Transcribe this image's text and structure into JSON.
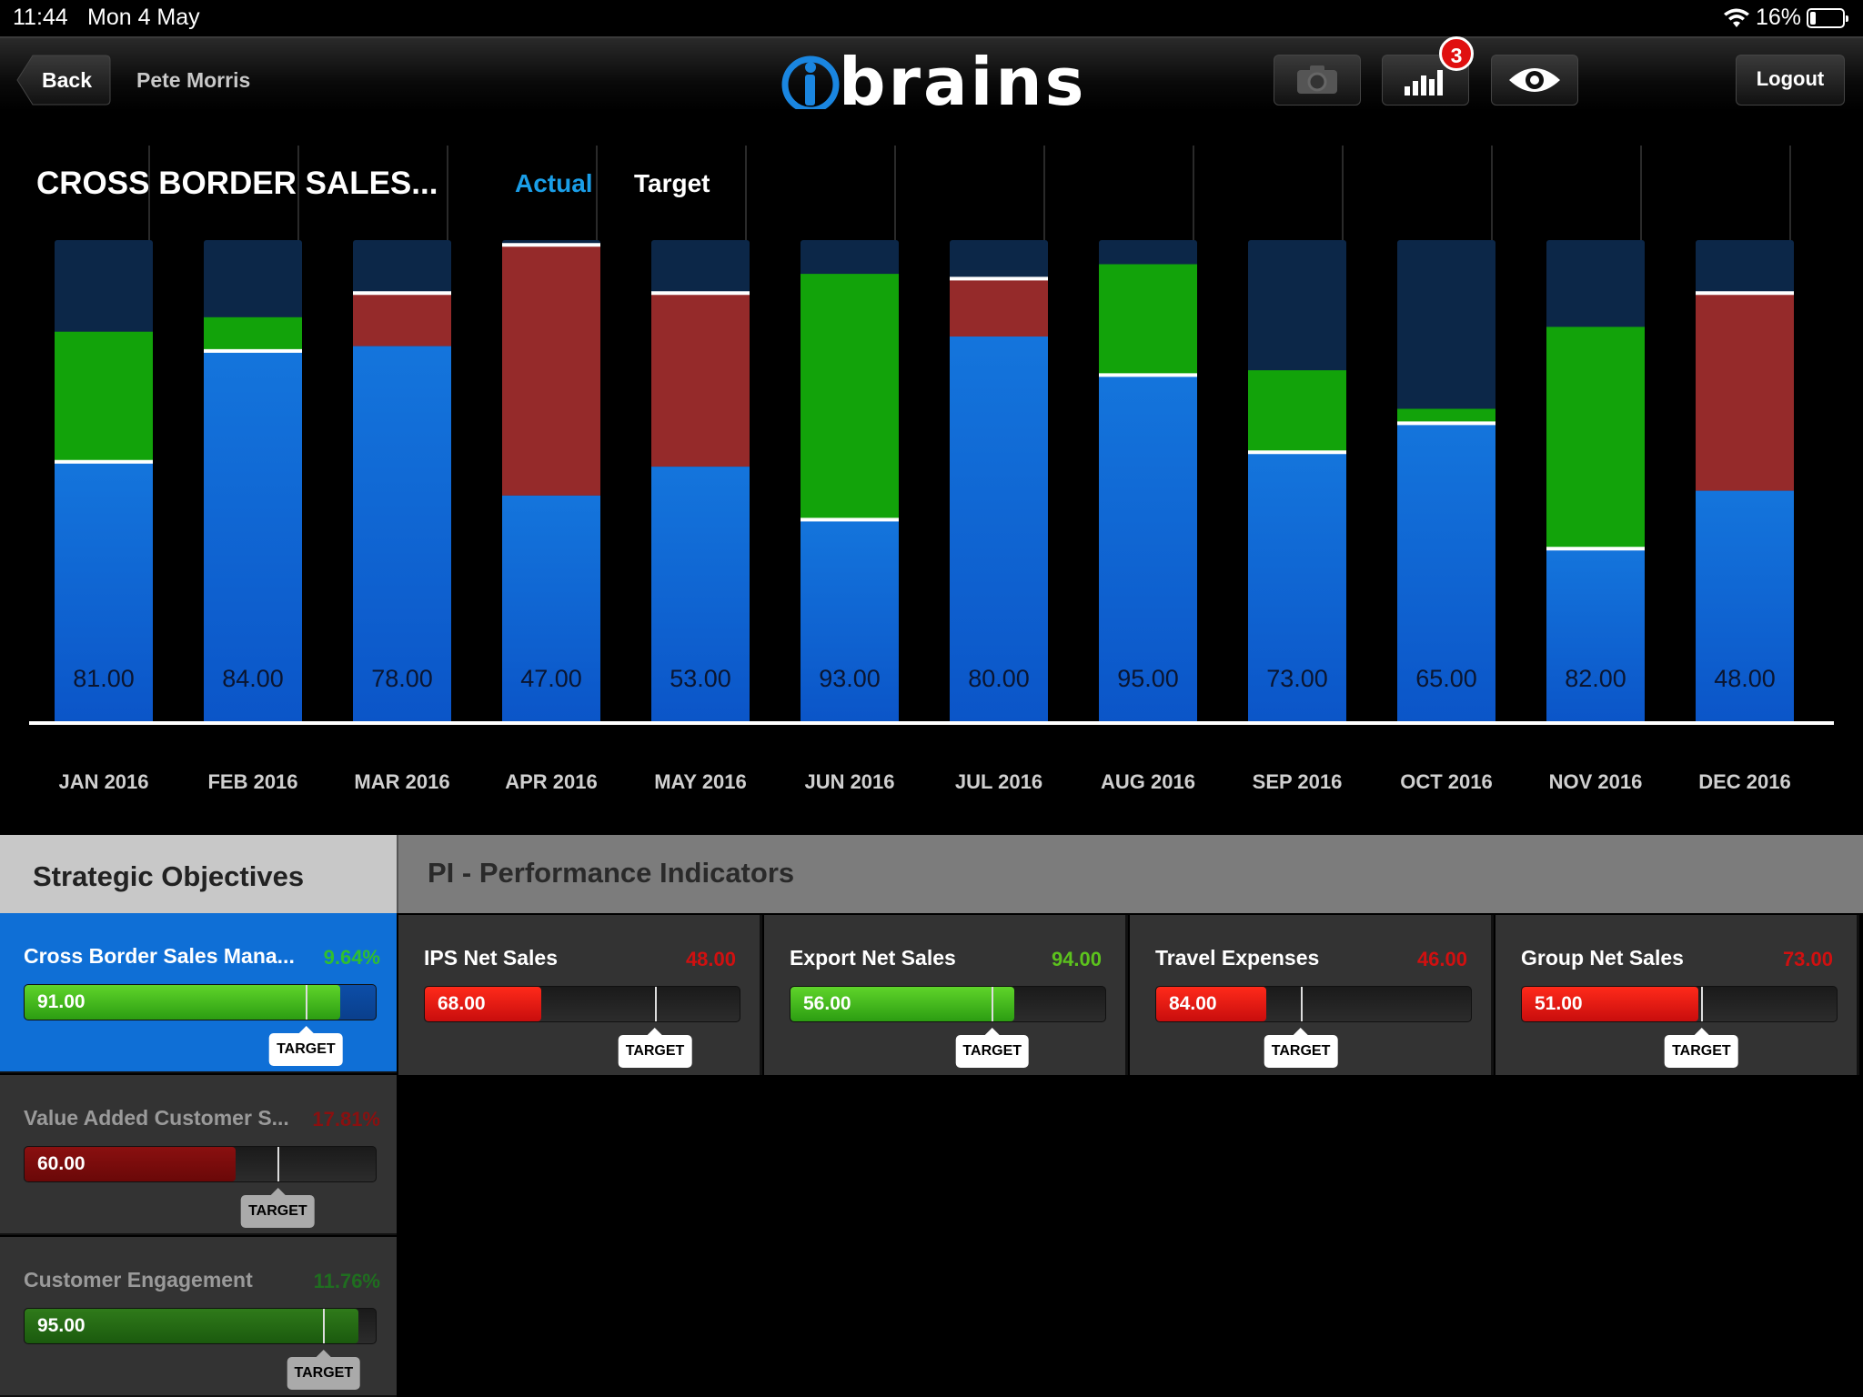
{
  "status": {
    "time": "11:44",
    "date": "Mon 4 May",
    "battery": "16%"
  },
  "nav": {
    "back_label": "Back",
    "user": "Pete Morris",
    "logo": "brains",
    "badge_count": "3",
    "logout_label": "Logout"
  },
  "chart": {
    "title": "CROSS BORDER SALES...",
    "legend_actual": "Actual",
    "legend_target": "Target"
  },
  "chart_data": {
    "type": "bar",
    "title": "CROSS BORDER SALES...",
    "categories": [
      "JAN 2016",
      "FEB 2016",
      "MAR 2016",
      "APR 2016",
      "MAY 2016",
      "JUN 2016",
      "JUL 2016",
      "AUG 2016",
      "SEP 2016",
      "OCT 2016",
      "NOV 2016",
      "DEC 2016"
    ],
    "series": [
      {
        "name": "Actual",
        "values": [
          81,
          84,
          78,
          47,
          53,
          93,
          80,
          95,
          73,
          65,
          82,
          48
        ]
      },
      {
        "name": "Target",
        "values": [
          54,
          77,
          89,
          99,
          89,
          42,
          92,
          72,
          56,
          62,
          36,
          89
        ]
      }
    ],
    "value_labels": [
      "81.00",
      "84.00",
      "78.00",
      "47.00",
      "53.00",
      "93.00",
      "80.00",
      "95.00",
      "73.00",
      "65.00",
      "82.00",
      "48.00"
    ],
    "ylim": [
      0,
      100
    ],
    "colors": {
      "actual": "#1166d6",
      "above_target": "#12a30a",
      "below_target": "#952a2a",
      "background_bar": "#0c2748",
      "target_line": "#ffffff"
    }
  },
  "strategic": {
    "header": "Strategic Objectives",
    "items": [
      {
        "name": "Cross Border Sales Mana...",
        "pct": "9.64%",
        "value": "91.00",
        "fill": 0.9,
        "target": 0.8,
        "target_label": "TARGET",
        "pct_color": "#2fbf2f",
        "fill_color": "green"
      },
      {
        "name": "Value Added Customer S...",
        "pct": "17.81%",
        "value": "60.00",
        "fill": 0.6,
        "target": 0.72,
        "target_label": "TARGET",
        "pct_color": "#8a1010",
        "fill_color": "darkred"
      },
      {
        "name": "Customer Engagement",
        "pct": "11.76%",
        "value": "95.00",
        "fill": 0.95,
        "target": 0.85,
        "target_label": "TARGET",
        "pct_color": "#1f6e1f",
        "fill_color": "darkgreen"
      }
    ]
  },
  "pi": {
    "header": "PI - Performance Indicators",
    "items": [
      {
        "name": "IPS Net Sales",
        "pct": "48.00",
        "value": "68.00",
        "fill": 0.37,
        "target": 0.73,
        "target_label": "TARGET",
        "pct_color": "#d01010",
        "fill_color": "red"
      },
      {
        "name": "Export Net Sales",
        "pct": "94.00",
        "value": "56.00",
        "fill": 0.71,
        "target": 0.64,
        "target_label": "TARGET",
        "pct_color": "#5cc21d",
        "fill_color": "green"
      },
      {
        "name": "Travel Expenses",
        "pct": "46.00",
        "value": "84.00",
        "fill": 0.35,
        "target": 0.46,
        "target_label": "TARGET",
        "pct_color": "#d01010",
        "fill_color": "red"
      },
      {
        "name": "Group Net Sales",
        "pct": "73.00",
        "value": "51.00",
        "fill": 0.56,
        "target": 0.57,
        "target_label": "TARGET",
        "pct_color": "#d01010",
        "fill_color": "red"
      }
    ]
  }
}
